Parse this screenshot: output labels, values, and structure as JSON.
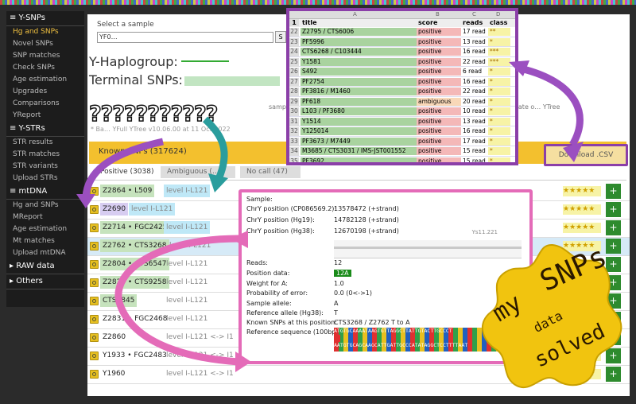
{
  "sidebar": {
    "sections": [
      {
        "title": "≡ Y-SNPs",
        "items": [
          "Hg and SNPs",
          "Novel SNPs",
          "SNP matches",
          "Check SNPs",
          "Age estimation",
          "Upgrades",
          "Comparisons",
          "YReport"
        ]
      },
      {
        "title": "≡ Y-STRs",
        "items": [
          "STR results",
          "STR matches",
          "STR variants",
          "Upload STRs"
        ]
      },
      {
        "title": "≡ mtDNA",
        "items": [
          "Hg and SNPs",
          "MReport",
          "Age estimation",
          "Mt matches",
          "Upload mtDNA"
        ]
      },
      {
        "title": "▸ RAW data",
        "items": []
      },
      {
        "title": "▸ Others",
        "items": []
      }
    ],
    "active_item": "Hg and SNPs"
  },
  "sample": {
    "label": "Select a sample",
    "value": "YF0…",
    "go_label": "S"
  },
  "header": {
    "haplogroup_label": "Y-Haplogroup:",
    "terminal_label": "Terminal SNPs:",
    "question_marks": "???????????",
    "note_left": "sampl",
    "note_right": "sing and update o… YTree",
    "small_note": "* Ba… YFull YTree v10.06.00 at 11 Oct 2022"
  },
  "known_snps": {
    "label": "Known SNPs (317624)",
    "download_label": "Download .CSV"
  },
  "tabs": [
    {
      "label": "Positive (3038)",
      "active": true
    },
    {
      "label": "Ambiguous (…)",
      "active": false
    },
    {
      "label": "No call (47)",
      "active": false
    }
  ],
  "rows": [
    {
      "snp": "Z2864 • L509",
      "level": "level I-L121",
      "color": "#c6e3bd"
    },
    {
      "snp": "Z2690",
      "level": "level I-L121",
      "color": "#d7cdf1"
    },
    {
      "snp": "Z2714 • FGC2425",
      "level": "level I-L121",
      "color": "#c6e3bd"
    },
    {
      "snp": "Z2762 • CTS3268",
      "level": "level I-L121",
      "color": "#c6e3bd"
    },
    {
      "snp": "Z2804 • CTS6547",
      "level": "level I-L121",
      "color": "#c6e3bd"
    },
    {
      "snp": "Z2825 • CTS9258",
      "level": "level I-L121",
      "color": "#c6e3bd"
    },
    {
      "snp": "CTS9845",
      "level": "level I-L121",
      "color": "#c6e3bd"
    },
    {
      "snp": "Z2831 • FGC2468",
      "level": "level I-L121",
      "color": "#ffffff"
    },
    {
      "snp": "Z2860",
      "level": "level I-L121 <-> I1",
      "color": "#ffffff"
    },
    {
      "snp": "Y1933 • FGC2483",
      "level": "level I-L121 <-> I1",
      "color": "#ffffff"
    },
    {
      "snp": "Y1960",
      "level": "level I-L121 <-> I1",
      "color": "#ffffff"
    }
  ],
  "stars": "★★★★★",
  "plus": "+",
  "spreadsheet": {
    "col_letters": [
      "A",
      "B",
      "C",
      "D"
    ],
    "headers": [
      "title",
      "score",
      "reads",
      "class"
    ],
    "rows": [
      [
        "22",
        "Z2795 / CTS6006",
        "positive",
        "17 read",
        "**"
      ],
      [
        "23",
        "PF5996",
        "positive",
        "13 read",
        "*"
      ],
      [
        "24",
        "CTS6268 / C103444",
        "positive",
        "16 read",
        "***"
      ],
      [
        "25",
        "Y1581",
        "positive",
        "22 read",
        "***"
      ],
      [
        "26",
        "S492",
        "positive",
        "6 read",
        "*"
      ],
      [
        "27",
        "PF2754",
        "positive",
        "16 read",
        "*"
      ],
      [
        "28",
        "PF3816 / M1460",
        "positive",
        "22 read",
        "*"
      ],
      [
        "29",
        "PF618",
        "ambiguous",
        "20 read",
        "*"
      ],
      [
        "30",
        "L103 / PF3680",
        "positive",
        "10 read",
        "*"
      ],
      [
        "31",
        "Y1514",
        "positive",
        "13 read",
        "*"
      ],
      [
        "32",
        "Y125014",
        "positive",
        "16 read",
        "*"
      ],
      [
        "33",
        "PF3673 / M7449",
        "positive",
        "17 read",
        "*"
      ],
      [
        "34",
        "M3685 / CTS3031 / IMS-JST001552",
        "positive",
        "15 read",
        "*"
      ],
      [
        "35",
        "PF3692",
        "positive",
        "15 read",
        "*"
      ]
    ]
  },
  "popup": {
    "sample_label": "Sample:",
    "fields": [
      {
        "label": "ChrY position (CP086569.2):",
        "value": "13578472 (+strand)"
      },
      {
        "label": "ChrY position (Hg19):",
        "value": "14782128 (+strand)"
      },
      {
        "label": "ChrY position (Hg38):",
        "value": "12670198 (+strand)"
      }
    ],
    "track_label": "Ys11.221",
    "reads_label": "Reads:",
    "reads_value": "12",
    "posdata_label": "Position data:",
    "posdata_value": "12A",
    "weight_label": "Weight for A:",
    "weight_value": "1.0",
    "prob_label": "Probability of error:",
    "prob_value": "0.0 (0<->1)",
    "allele_label": "Sample allele:",
    "allele_value": "A",
    "ref_label": "Reference allele (Hg38):",
    "ref_value": "T",
    "known_label": "Known SNPs at this position:",
    "known_value": "CTS3268 / Z2762  T to A",
    "seq_label": "Reference sequence (100bp):",
    "seq_line1": "ATGTGCAAAATAAGTGTTAGGCTTATTGTACTTGCCCT",
    "seq_line2": "AATGTGCAGCAAGCATTGATTGCCCATATAGGCTCCTTTTAAT"
  },
  "sticker": {
    "text": "mySNPs data solved"
  }
}
